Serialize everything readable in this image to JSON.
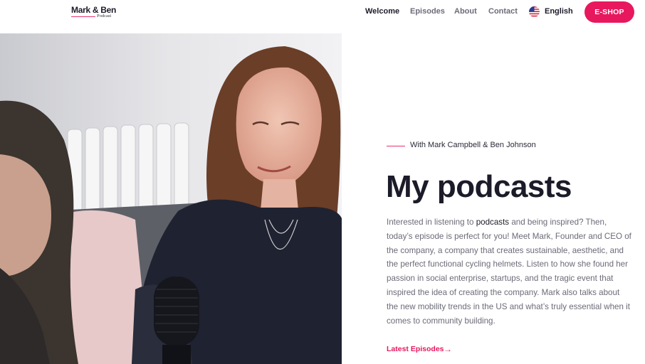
{
  "header": {
    "logo_main": "Mark & Ben",
    "logo_sub": "Podcast",
    "nav": [
      "Welcome",
      "Episodes",
      "About",
      "Contact"
    ],
    "active_nav": "Welcome",
    "language": "English",
    "language_flag_icon": "us-flag-icon",
    "eshop_label": "E-SHOP",
    "accent_color": "#e8185e"
  },
  "hero": {
    "eyebrow": "With Mark Campbell & Ben Johnson",
    "title": "My podcasts",
    "body_before": "Interested in listening to ",
    "body_highlight": "podcasts",
    "body_after": " and being inspired? Then, today’s episode is perfect for you! Meet Mark, Founder and CEO of the company, a company that creates sustainable, aesthetic, and the perfect functional cycling helmets. Listen to how she found her passion in social enterprise, startups, and the tragic event that inspired the idea of creating the company. Mark also talks about the new mobility trends in the US and what’s truly essential when it comes to community building.",
    "latest_label": "Latest Episodes",
    "latest_icon": "arrow-right-icon"
  }
}
